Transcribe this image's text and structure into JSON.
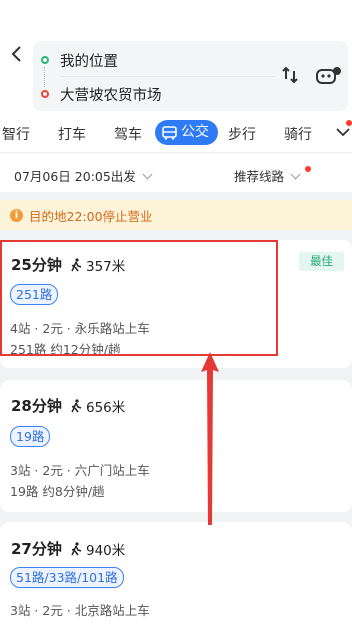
{
  "route": {
    "start": "我的位置",
    "end": "大营坡农贸市场"
  },
  "icons": {
    "back": "back-arrow-icon",
    "swap": "swap-icon",
    "robot": "robot-assistant-icon",
    "bus": "bus-icon",
    "walk": "walk-icon",
    "info": "info-icon",
    "more": "chevron-down-icon"
  },
  "modes": {
    "smart": "智行",
    "taxi": "打车",
    "drive": "驾车",
    "bus": "公交",
    "walk": "步行",
    "ride": "骑行"
  },
  "filter": {
    "depart": "07月06日 20:05出发",
    "sort": "推荐线路"
  },
  "notice": {
    "text": "目的地22:00停止营业"
  },
  "routes": [
    {
      "time": "25分钟",
      "walk": "357米",
      "lines": "251路",
      "summary": "4站 · 2元 · 永乐路站上车",
      "frequency": "251路 约12分钟/趟",
      "badge": "最佳"
    },
    {
      "time": "28分钟",
      "walk": "656米",
      "lines": "19路",
      "summary": "3站 · 2元 · 六广门站上车",
      "frequency": "19路 约8分钟/趟"
    },
    {
      "time": "27分钟",
      "walk": "940米",
      "lines": "51路/33路/101路",
      "summary": "3站 · 2元 · 北京路站上车"
    }
  ],
  "colors": {
    "accent": "#2f7bf5",
    "annotation_red": "#e53935",
    "best_green": "#2aa878",
    "notice_orange": "#d26a1c"
  }
}
